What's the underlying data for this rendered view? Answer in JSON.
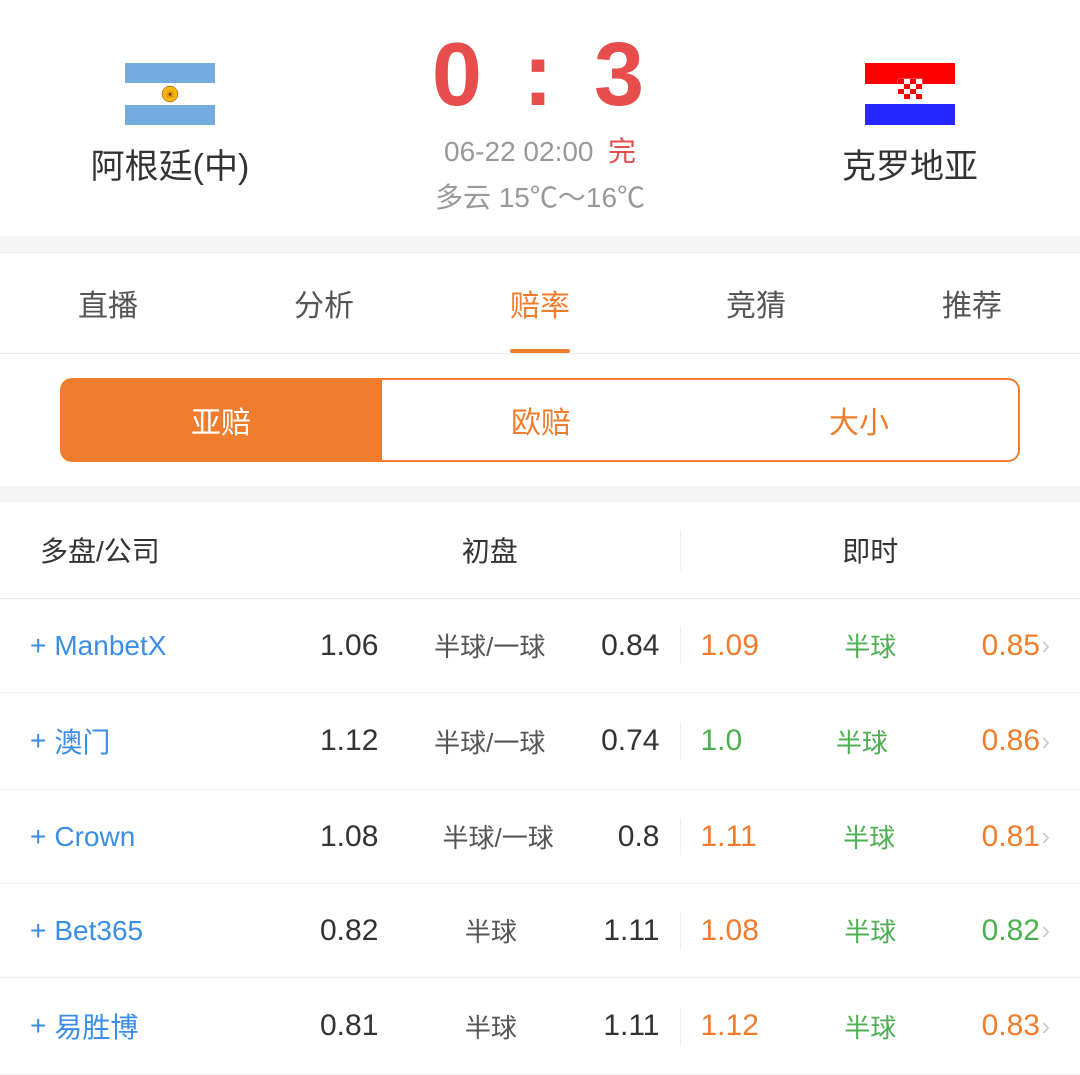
{
  "header": {
    "team_home": "阿根廷(中)",
    "team_away": "克罗地亚",
    "score": "0 : 3",
    "score_home": "0",
    "score_separator": ":",
    "score_away": "3",
    "match_date": "06-22 02:00",
    "match_status": "完",
    "weather": "多云  15℃～16℃"
  },
  "tabs": [
    {
      "label": "直播",
      "active": false
    },
    {
      "label": "分析",
      "active": false
    },
    {
      "label": "赔率",
      "active": true
    },
    {
      "label": "竞猜",
      "active": false
    },
    {
      "label": "推荐",
      "active": false
    }
  ],
  "sub_tabs": [
    {
      "label": "亚赔",
      "active": true
    },
    {
      "label": "欧赔",
      "active": false
    },
    {
      "label": "大小",
      "active": false
    }
  ],
  "table": {
    "header_company": "多盘/公司",
    "header_initial": "初盘",
    "header_realtime": "即时",
    "rows": [
      {
        "company": "ManbetX",
        "initial_left": "1.06",
        "initial_mid": "半球/一球",
        "initial_right": "0.84",
        "realtime_left": "1.09",
        "realtime_left_color": "orange",
        "realtime_mid": "半球",
        "realtime_mid_color": "green",
        "realtime_right": "0.85",
        "realtime_right_color": "orange"
      },
      {
        "company": "澳门",
        "initial_left": "1.12",
        "initial_mid": "半球/一球",
        "initial_right": "0.74",
        "realtime_left": "1.0",
        "realtime_left_color": "green",
        "realtime_mid": "半球",
        "realtime_mid_color": "green",
        "realtime_right": "0.86",
        "realtime_right_color": "orange"
      },
      {
        "company": "Crown",
        "initial_left": "1.08",
        "initial_mid": "半球/一球",
        "initial_right": "0.8",
        "realtime_left": "1.11",
        "realtime_left_color": "orange",
        "realtime_mid": "半球",
        "realtime_mid_color": "green",
        "realtime_right": "0.81",
        "realtime_right_color": "orange"
      },
      {
        "company": "Bet365",
        "initial_left": "0.82",
        "initial_mid": "半球",
        "initial_right": "1.11",
        "realtime_left": "1.08",
        "realtime_left_color": "orange",
        "realtime_mid": "半球",
        "realtime_mid_color": "green",
        "realtime_right": "0.82",
        "realtime_right_color": "green"
      },
      {
        "company": "易胜博",
        "initial_left": "0.81",
        "initial_mid": "半球",
        "initial_right": "1.11",
        "realtime_left": "1.12",
        "realtime_left_color": "orange",
        "realtime_mid": "半球",
        "realtime_mid_color": "green",
        "realtime_right": "0.83",
        "realtime_right_color": "orange"
      }
    ]
  },
  "icons": {
    "plus": "+",
    "arrow": "›"
  }
}
